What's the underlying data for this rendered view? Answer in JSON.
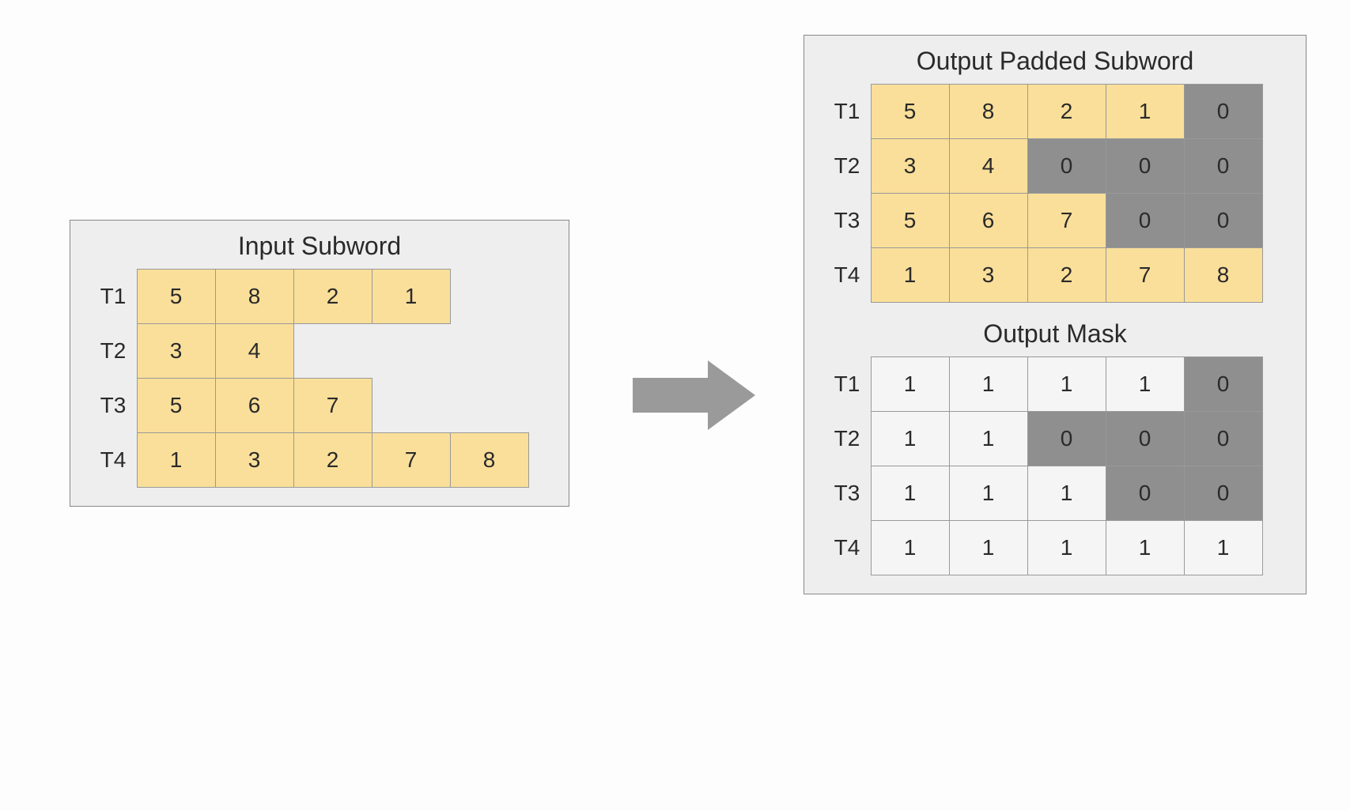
{
  "input": {
    "title": "Input Subword",
    "rows": [
      {
        "label": "T1",
        "cells": [
          5,
          8,
          2,
          1
        ]
      },
      {
        "label": "T2",
        "cells": [
          3,
          4
        ]
      },
      {
        "label": "T3",
        "cells": [
          5,
          6,
          7
        ]
      },
      {
        "label": "T4",
        "cells": [
          1,
          3,
          2,
          7,
          8
        ]
      }
    ],
    "max_cols": 5
  },
  "output_padded": {
    "title": "Output Padded Subword",
    "rows": [
      {
        "label": "T1",
        "cells": [
          {
            "v": 5,
            "pad": false
          },
          {
            "v": 8,
            "pad": false
          },
          {
            "v": 2,
            "pad": false
          },
          {
            "v": 1,
            "pad": false
          },
          {
            "v": 0,
            "pad": true
          }
        ]
      },
      {
        "label": "T2",
        "cells": [
          {
            "v": 3,
            "pad": false
          },
          {
            "v": 4,
            "pad": false
          },
          {
            "v": 0,
            "pad": true
          },
          {
            "v": 0,
            "pad": true
          },
          {
            "v": 0,
            "pad": true
          }
        ]
      },
      {
        "label": "T3",
        "cells": [
          {
            "v": 5,
            "pad": false
          },
          {
            "v": 6,
            "pad": false
          },
          {
            "v": 7,
            "pad": false
          },
          {
            "v": 0,
            "pad": true
          },
          {
            "v": 0,
            "pad": true
          }
        ]
      },
      {
        "label": "T4",
        "cells": [
          {
            "v": 1,
            "pad": false
          },
          {
            "v": 3,
            "pad": false
          },
          {
            "v": 2,
            "pad": false
          },
          {
            "v": 7,
            "pad": false
          },
          {
            "v": 8,
            "pad": false
          }
        ]
      }
    ]
  },
  "output_mask": {
    "title": "Output Mask",
    "rows": [
      {
        "label": "T1",
        "cells": [
          {
            "v": 1,
            "pad": false
          },
          {
            "v": 1,
            "pad": false
          },
          {
            "v": 1,
            "pad": false
          },
          {
            "v": 1,
            "pad": false
          },
          {
            "v": 0,
            "pad": true
          }
        ]
      },
      {
        "label": "T2",
        "cells": [
          {
            "v": 1,
            "pad": false
          },
          {
            "v": 1,
            "pad": false
          },
          {
            "v": 0,
            "pad": true
          },
          {
            "v": 0,
            "pad": true
          },
          {
            "v": 0,
            "pad": true
          }
        ]
      },
      {
        "label": "T3",
        "cells": [
          {
            "v": 1,
            "pad": false
          },
          {
            "v": 1,
            "pad": false
          },
          {
            "v": 1,
            "pad": false
          },
          {
            "v": 0,
            "pad": true
          },
          {
            "v": 0,
            "pad": true
          }
        ]
      },
      {
        "label": "T4",
        "cells": [
          {
            "v": 1,
            "pad": false
          },
          {
            "v": 1,
            "pad": false
          },
          {
            "v": 1,
            "pad": false
          },
          {
            "v": 1,
            "pad": false
          },
          {
            "v": 1,
            "pad": false
          }
        ]
      }
    ]
  },
  "chart_data": {
    "type": "table",
    "title": "Subword padding and mask illustration",
    "input_subword": {
      "T1": [
        5,
        8,
        2,
        1
      ],
      "T2": [
        3,
        4
      ],
      "T3": [
        5,
        6,
        7
      ],
      "T4": [
        1,
        3,
        2,
        7,
        8
      ]
    },
    "output_padded_subword": {
      "T1": [
        5,
        8,
        2,
        1,
        0
      ],
      "T2": [
        3,
        4,
        0,
        0,
        0
      ],
      "T3": [
        5,
        6,
        7,
        0,
        0
      ],
      "T4": [
        1,
        3,
        2,
        7,
        8
      ]
    },
    "output_mask": {
      "T1": [
        1,
        1,
        1,
        1,
        0
      ],
      "T2": [
        1,
        1,
        0,
        0,
        0
      ],
      "T3": [
        1,
        1,
        1,
        0,
        0
      ],
      "T4": [
        1,
        1,
        1,
        1,
        1
      ]
    }
  }
}
